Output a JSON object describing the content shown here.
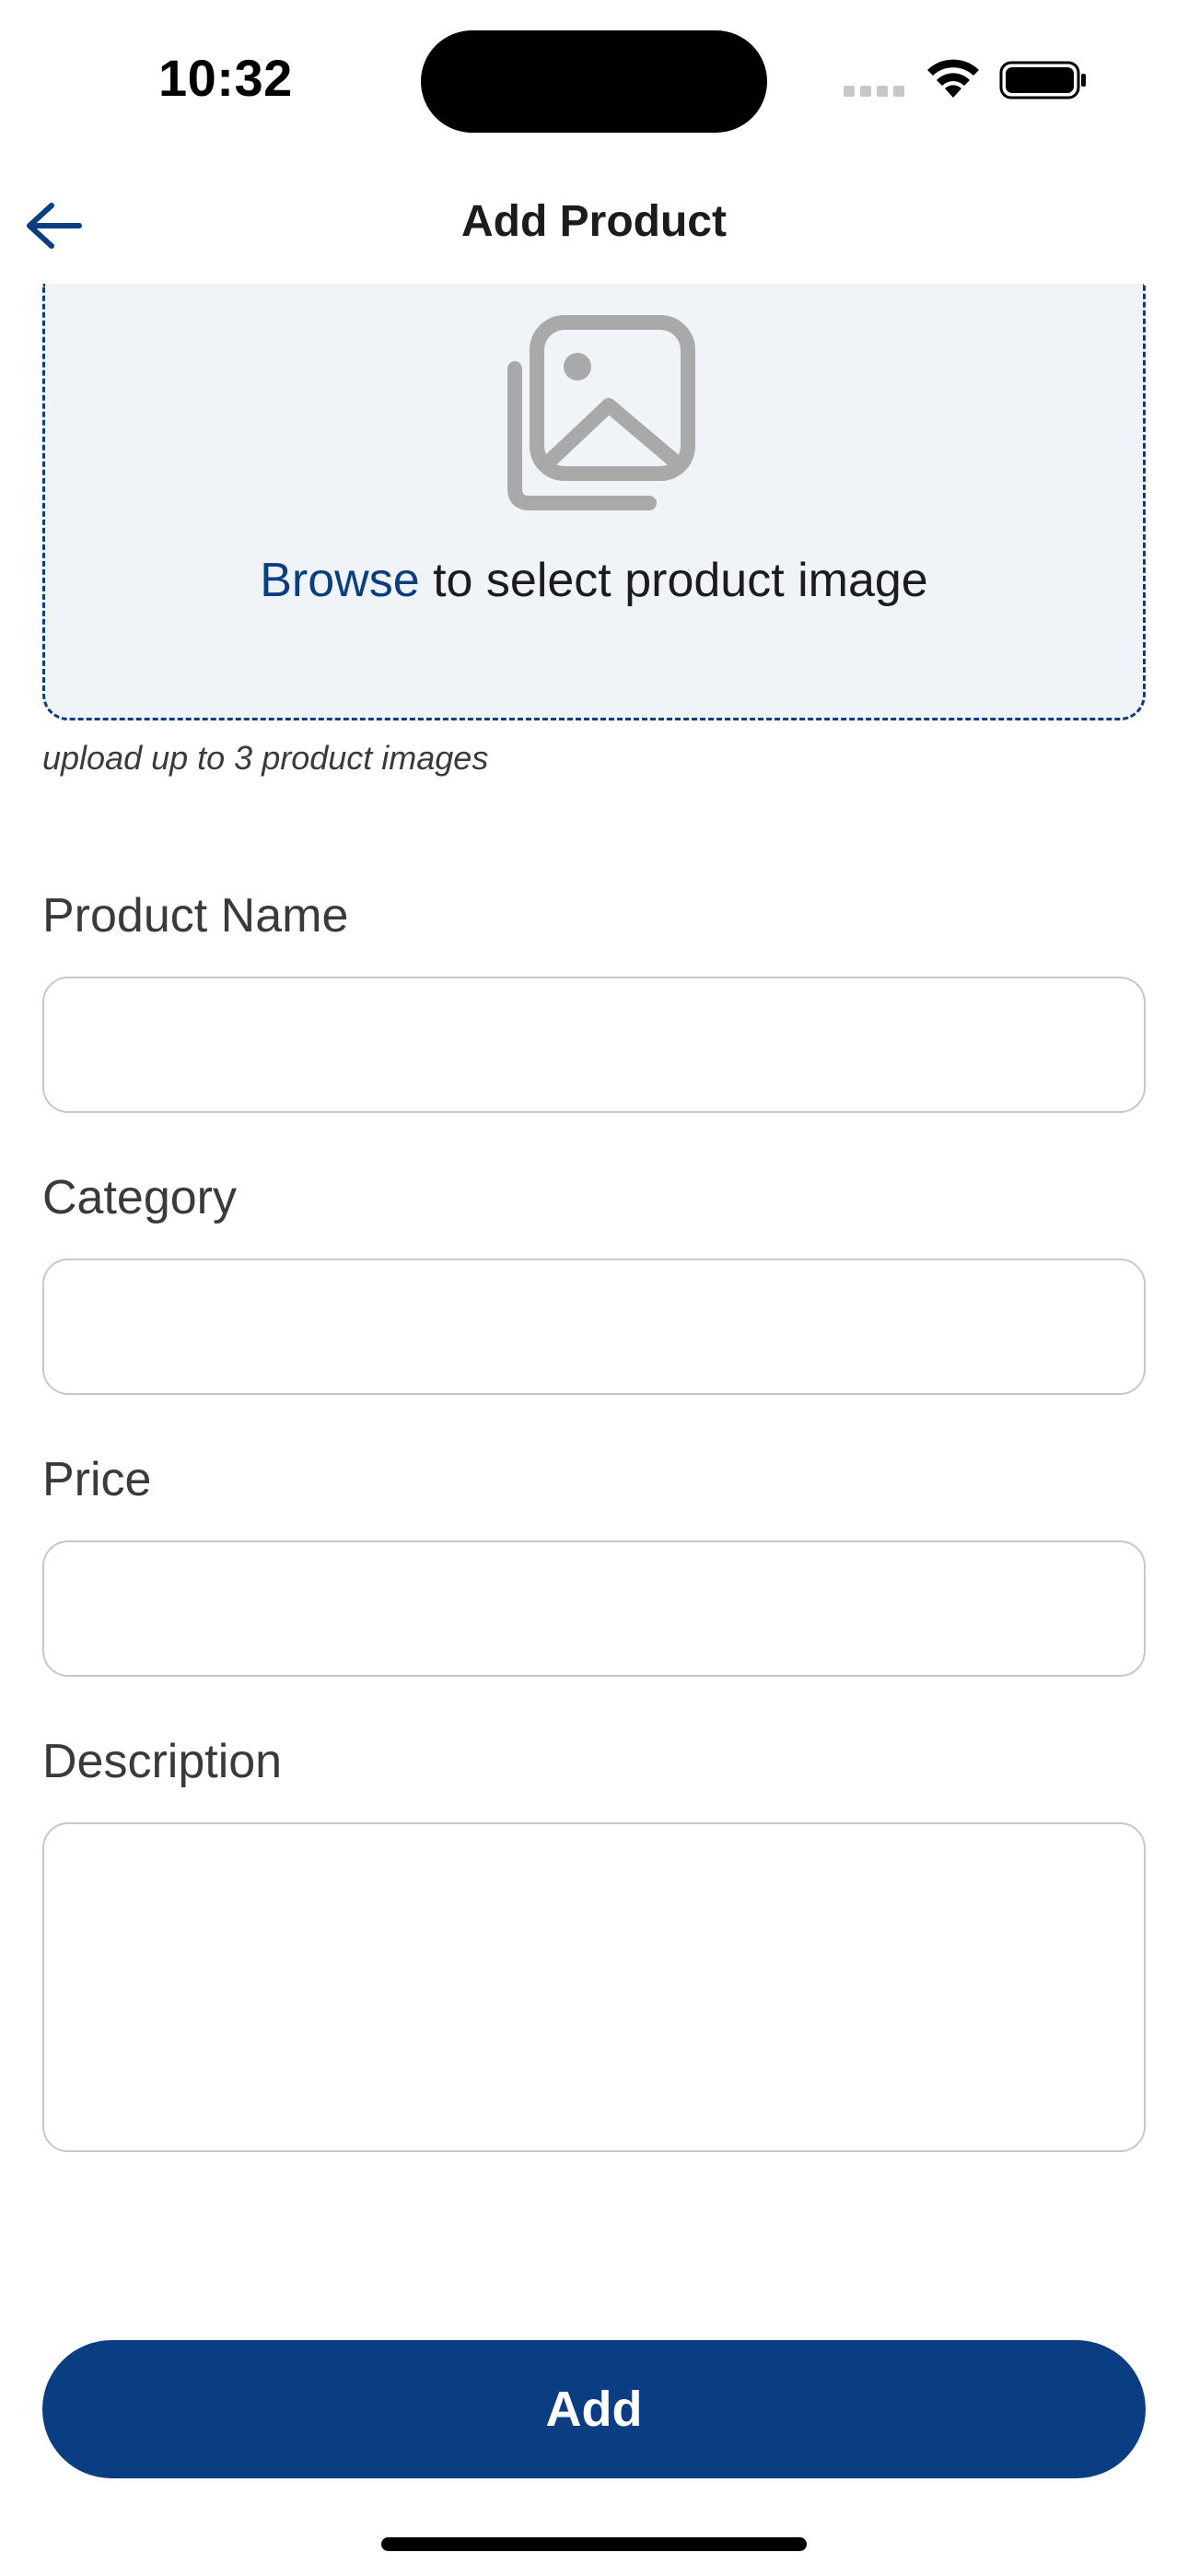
{
  "status_bar": {
    "time": "10:32"
  },
  "nav": {
    "title": "Add Product",
    "back_icon": "arrow-left-icon"
  },
  "upload": {
    "icon": "image-gallery-icon",
    "browse_label": "Browse",
    "text_suffix": " to select product image",
    "hint": "upload up to 3 product images"
  },
  "form": {
    "product_name": {
      "label": "Product Name",
      "value": ""
    },
    "category": {
      "label": "Category",
      "value": ""
    },
    "price": {
      "label": "Price",
      "value": ""
    },
    "description": {
      "label": "Description",
      "value": ""
    }
  },
  "actions": {
    "add_label": "Add"
  },
  "colors": {
    "accent": "#0a3d82",
    "upload_bg": "#f0f3f8",
    "field_border": "#c7c7cc",
    "icon_gray": "#a9a9a9"
  }
}
